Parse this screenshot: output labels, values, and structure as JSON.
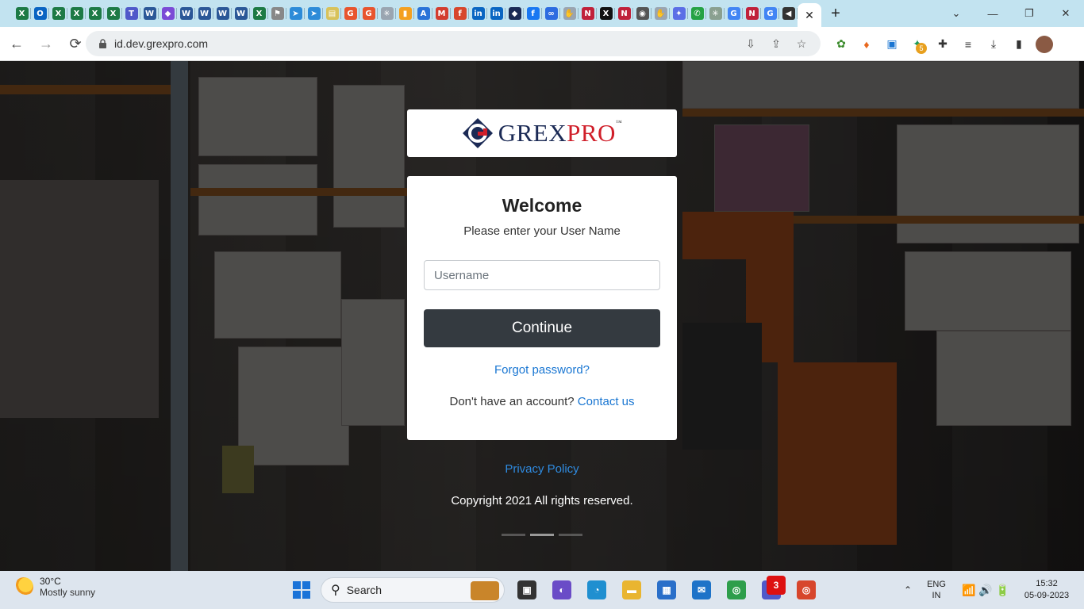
{
  "browser": {
    "tabs": [
      {
        "icon": "excel-icon",
        "glyph": "X",
        "color": "#1d7a45"
      },
      {
        "icon": "outlook-icon",
        "glyph": "O",
        "color": "#0a64c2"
      },
      {
        "icon": "excel-icon",
        "glyph": "X",
        "color": "#1d7a45"
      },
      {
        "icon": "excel-icon",
        "glyph": "X",
        "color": "#1d7a45"
      },
      {
        "icon": "excel-icon",
        "glyph": "X",
        "color": "#1d7a45"
      },
      {
        "icon": "excel-icon",
        "glyph": "X",
        "color": "#1d7a45"
      },
      {
        "icon": "teams-icon",
        "glyph": "T",
        "color": "#5059c9"
      },
      {
        "icon": "word-icon",
        "glyph": "W",
        "color": "#2b5797"
      },
      {
        "icon": "loop-icon",
        "glyph": "◆",
        "color": "#7b4bd6"
      },
      {
        "icon": "word-icon",
        "glyph": "W",
        "color": "#2b5797"
      },
      {
        "icon": "word-icon",
        "glyph": "W",
        "color": "#2b5797"
      },
      {
        "icon": "word-icon",
        "glyph": "W",
        "color": "#2b5797"
      },
      {
        "icon": "word-icon",
        "glyph": "W",
        "color": "#2b5797"
      },
      {
        "icon": "excel-icon",
        "glyph": "X",
        "color": "#1d7a45"
      },
      {
        "icon": "vpn-icon",
        "glyph": "⚑",
        "color": "#888888"
      },
      {
        "icon": "flow-icon",
        "glyph": "➤",
        "color": "#2d8bd8"
      },
      {
        "icon": "flow-icon",
        "glyph": "➤",
        "color": "#2d8bd8"
      },
      {
        "icon": "note-icon",
        "glyph": "▤",
        "color": "#d8c25a"
      },
      {
        "icon": "grammarly-icon",
        "glyph": "G",
        "color": "#e8542e"
      },
      {
        "icon": "grammarly-icon",
        "glyph": "G",
        "color": "#e8542e"
      },
      {
        "icon": "canva-icon",
        "glyph": "✳",
        "color": "#9aa5b1"
      },
      {
        "icon": "analytics-icon",
        "glyph": "▮",
        "color": "#f4a020"
      },
      {
        "icon": "ads-icon",
        "glyph": "A",
        "color": "#2a73d8"
      },
      {
        "icon": "gmail-icon",
        "glyph": "M",
        "color": "#d33d2f"
      },
      {
        "icon": "facebook-icon",
        "glyph": "f",
        "color": "#d7462c"
      },
      {
        "icon": "linkedin-icon",
        "glyph": "in",
        "color": "#0a66c2"
      },
      {
        "icon": "linkedin-icon",
        "glyph": "in",
        "color": "#0a66c2"
      },
      {
        "icon": "diamond-icon",
        "glyph": "◆",
        "color": "#1b2a55"
      },
      {
        "icon": "facebook-icon",
        "glyph": "f",
        "color": "#1877f2"
      },
      {
        "icon": "meta-icon",
        "glyph": "∞",
        "color": "#2d6ce0"
      },
      {
        "icon": "hand-icon",
        "glyph": "✋",
        "color": "#9aa5b1"
      },
      {
        "icon": "n-icon",
        "glyph": "N",
        "color": "#c0213a"
      },
      {
        "icon": "x-icon",
        "glyph": "X",
        "color": "#111111"
      },
      {
        "icon": "n-icon",
        "glyph": "N",
        "color": "#c0213a"
      },
      {
        "icon": "globe-icon",
        "glyph": "◉",
        "color": "#555555"
      },
      {
        "icon": "hand-icon",
        "glyph": "✋",
        "color": "#9aa5b1"
      },
      {
        "icon": "sparkle-icon",
        "glyph": "✦",
        "color": "#5b6ee6"
      },
      {
        "icon": "whatsapp-icon",
        "glyph": "✆",
        "color": "#25a244"
      },
      {
        "icon": "canva-icon",
        "glyph": "✳",
        "color": "#8aa090"
      },
      {
        "icon": "google-icon",
        "glyph": "G",
        "color": "#4285f4"
      },
      {
        "icon": "n-icon",
        "glyph": "N",
        "color": "#c0213a"
      },
      {
        "icon": "google-icon",
        "glyph": "G",
        "color": "#4285f4"
      },
      {
        "icon": "audio-icon",
        "glyph": "◀",
        "color": "#333333"
      }
    ],
    "active_tab_close": "✕",
    "new_tab": "+",
    "window_controls": {
      "tab_search": "⌄",
      "minimize": "—",
      "maximize": "❐",
      "close": "✕"
    },
    "nav": {
      "back": "←",
      "forward": "→",
      "reload": "⟳"
    },
    "url": "id.dev.grexpro.com",
    "omnibox_actions": {
      "install": "⇩",
      "share": "⇪",
      "bookmark": "☆"
    },
    "extensions": [
      {
        "icon": "ext-leaf-icon",
        "glyph": "✿",
        "color": "#3a8a2a"
      },
      {
        "icon": "ext-flame-icon",
        "glyph": "♦",
        "color": "#e8681e"
      },
      {
        "icon": "ext-square-icon",
        "glyph": "▣",
        "color": "#1a75d2"
      },
      {
        "icon": "ext-colorful-icon",
        "glyph": "✦",
        "color": "#1a9a5a",
        "badge": "5"
      },
      {
        "icon": "puzzle-icon",
        "glyph": "✚",
        "color": "#333333"
      },
      {
        "icon": "media-icon",
        "glyph": "≡",
        "color": "#333333"
      },
      {
        "icon": "download-icon",
        "glyph": "⤓",
        "color": "#333333"
      },
      {
        "icon": "sidepanel-icon",
        "glyph": "▮",
        "color": "#333333"
      },
      {
        "icon": "profile-avatar",
        "glyph": "",
        "color": "#8a5a44"
      }
    ]
  },
  "page": {
    "logo_brand_grex": "GREX",
    "logo_brand_pro": "PRO",
    "logo_tm": "™",
    "welcome": "Welcome",
    "subtitle": "Please enter your User Name",
    "username_placeholder": "Username",
    "continue_label": "Continue",
    "forgot_label": "Forgot password?",
    "signup_prefix": "Don't have an account? ",
    "contact_label": "Contact us",
    "privacy_label": "Privacy Policy",
    "copyright": "Copyright 2021 All rights reserved."
  },
  "taskbar": {
    "weather_temp": "30°C",
    "weather_desc": "Mostly sunny",
    "search_label": "Search",
    "apps": [
      {
        "icon": "task-view-icon",
        "glyph": "▣",
        "color": "#333333"
      },
      {
        "icon": "meet-icon",
        "glyph": "◐",
        "color": "#6a4cc7"
      },
      {
        "icon": "edge-icon",
        "glyph": "◔",
        "color": "#1f8fd0"
      },
      {
        "icon": "explorer-icon",
        "glyph": "▬",
        "color": "#e9b530"
      },
      {
        "icon": "store-icon",
        "glyph": "▦",
        "color": "#2a6fc9"
      },
      {
        "icon": "mail-icon",
        "glyph": "✉",
        "color": "#1e73c8"
      },
      {
        "icon": "chrome-icon",
        "glyph": "◎",
        "color": "#2e9e4b"
      },
      {
        "icon": "teams-icon",
        "glyph": "T",
        "color": "#5059c9",
        "badge": "3"
      },
      {
        "icon": "chrome-profile-icon",
        "glyph": "◎",
        "color": "#d7462c"
      }
    ],
    "tray_chevron": "⌃",
    "lang_1": "ENG",
    "lang_2": "IN",
    "sys_icons": "📶 🔊 🔋",
    "time": "15:32",
    "date": "05-09-2023"
  }
}
